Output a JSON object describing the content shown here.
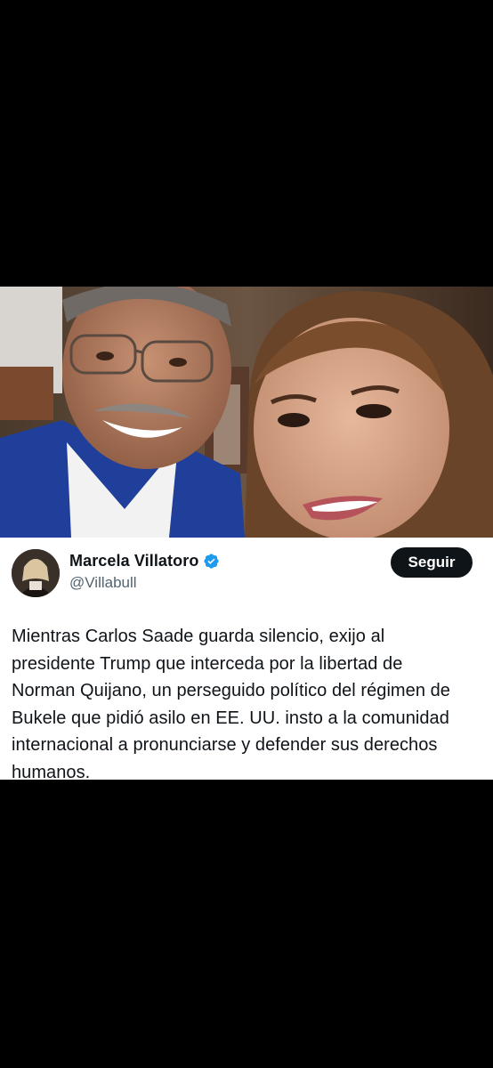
{
  "photo": {
    "alt_icon": "selfie-photo"
  },
  "tweet": {
    "author": {
      "display_name": "Marcela Villatoro",
      "handle": "@Villabull",
      "verified_icon": "verified-badge-icon",
      "verified_color": "#1d9bf0"
    },
    "follow_label": "Seguir",
    "text_lines": [
      "Mientras Carlos Saade guarda silencio, exijo al",
      "presidente Trump que interceda por la libertad de",
      "Norman Quijano, un perseguido político del régimen de",
      "Bukele que pidió asilo en EE. UU. insto a la comunidad",
      "internacional a pronunciarse y defender sus derechos",
      "humanos."
    ]
  },
  "colors": {
    "background": "#000000",
    "card": "#ffffff",
    "text_primary": "#0f1419",
    "text_secondary": "#536471",
    "button_bg": "#0f1419"
  }
}
